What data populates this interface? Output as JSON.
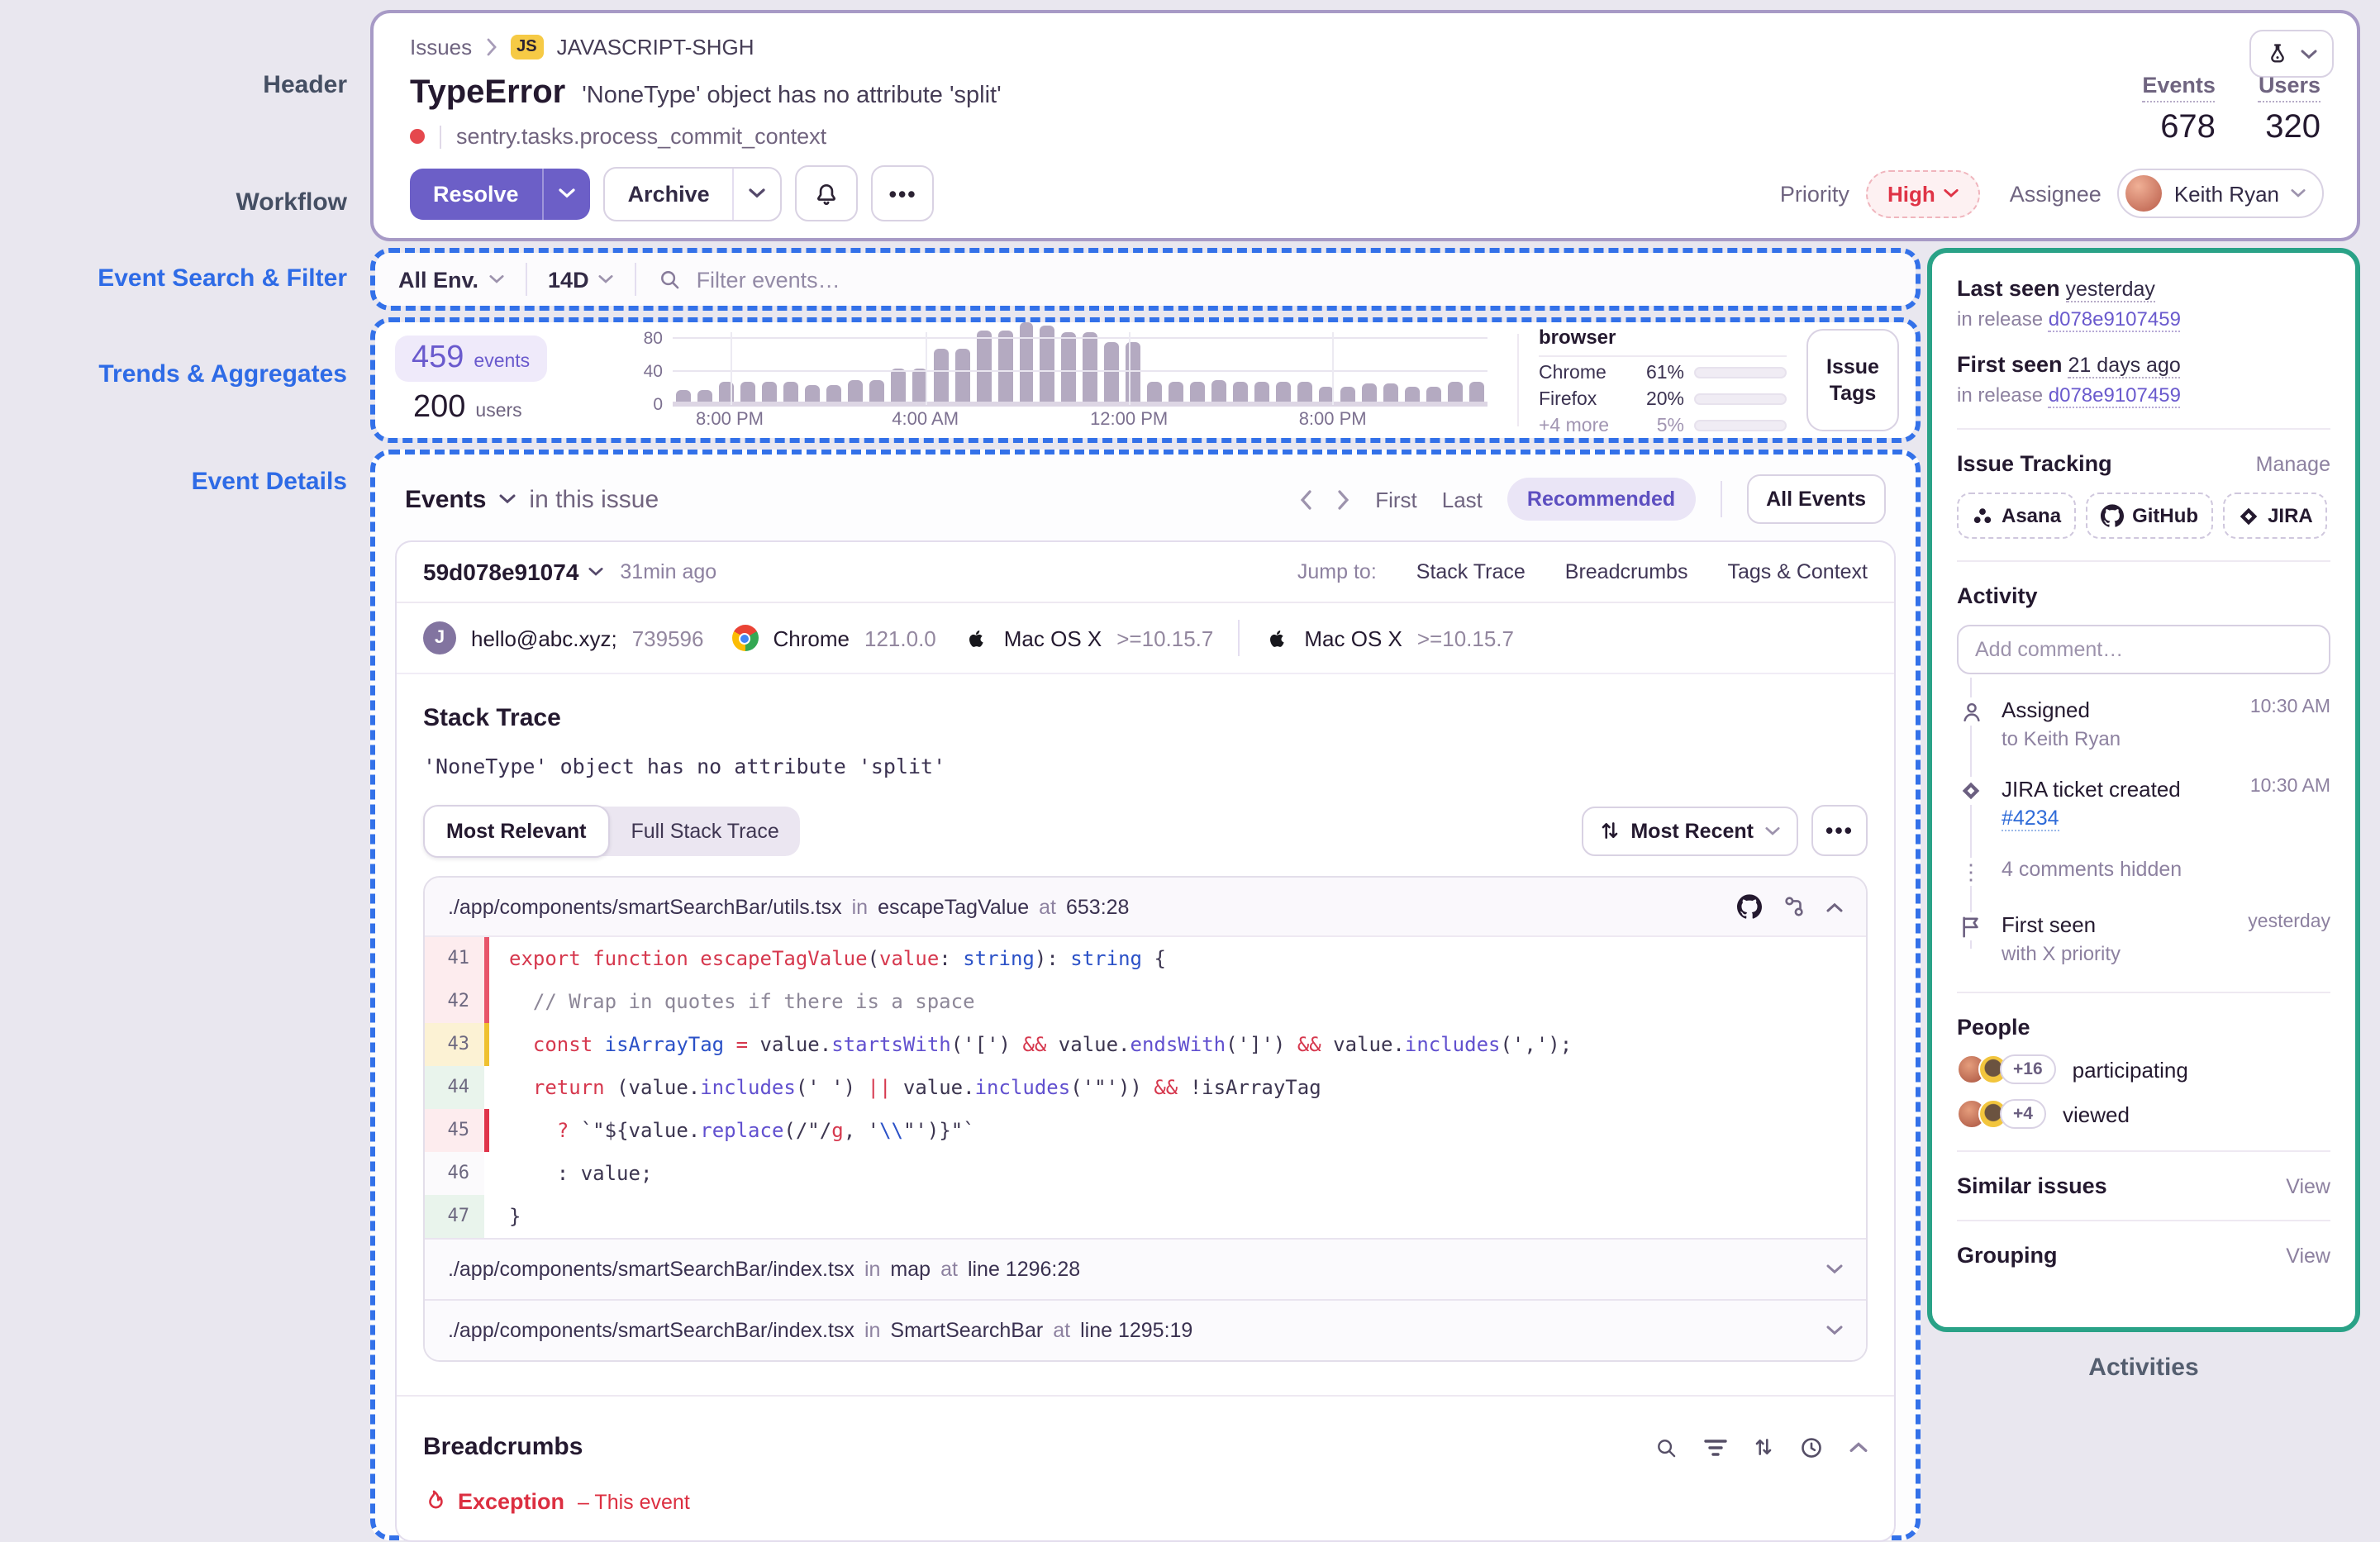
{
  "colors": {
    "accent_purple": "#6c5fc7",
    "error_red": "#e0344a",
    "annotation_blue": "#3371e9",
    "annotation_green": "#2aa287",
    "platform_badge_yellow": "#f6ca45",
    "chart_bar": "#b4aac1"
  },
  "annotations": {
    "header": "Header",
    "workflow": "Workflow",
    "search": "Event Search & Filter",
    "trends": "Trends & Aggregates",
    "details": "Event Details",
    "activities": "Activities"
  },
  "header": {
    "breadcrumb": {
      "issues": "Issues",
      "platform_badge": "JS",
      "project": "JAVASCRIPT-SHGH"
    },
    "title": "TypeError",
    "message": "'NoneType' object has no attribute 'split'",
    "culprit": "sentry.tasks.process_commit_context",
    "stats": {
      "events_label": "Events",
      "events_value": "678",
      "users_label": "Users",
      "users_value": "320"
    }
  },
  "workflow": {
    "resolve": "Resolve",
    "archive": "Archive",
    "priority_label": "Priority",
    "priority_value": "High",
    "assignee_label": "Assignee",
    "assignee_name": "Keith Ryan"
  },
  "filters": {
    "environment": "All Env.",
    "date_range": "14D",
    "search_placeholder": "Filter events…"
  },
  "trends": {
    "events_count": "459",
    "events_unit": "events",
    "users_count": "200",
    "users_unit": "users",
    "chart_data": {
      "type": "bar",
      "values": [
        18,
        18,
        28,
        28,
        28,
        28,
        24,
        24,
        31,
        31,
        45,
        45,
        68,
        68,
        90,
        90,
        100,
        96,
        88,
        88,
        76,
        76,
        28,
        28,
        29,
        30,
        28,
        28,
        28,
        28,
        22,
        22,
        26,
        26,
        22,
        22,
        28,
        28
      ],
      "ylim": [
        0,
        100
      ],
      "yticks": [
        0,
        40,
        80
      ],
      "xticks": [
        {
          "label": "8:00 PM",
          "pos": 7
        },
        {
          "label": "4:00 AM",
          "pos": 31
        },
        {
          "label": "12:00 PM",
          "pos": 56
        },
        {
          "label": "8:00 PM",
          "pos": 81
        }
      ],
      "grid": true,
      "legend": "none"
    },
    "browser": {
      "title": "browser",
      "rows": [
        {
          "name": "Chrome",
          "pct": "61%",
          "fill": 61,
          "muted": false
        },
        {
          "name": "Firefox",
          "pct": "20%",
          "fill": 20,
          "muted": false
        },
        {
          "name": "+4 more",
          "pct": "5%",
          "fill": 5,
          "muted": true
        }
      ]
    },
    "issue_tags_line1": "Issue",
    "issue_tags_line2": "Tags"
  },
  "events_header": {
    "title": "Events",
    "subtitle": "in this issue",
    "first": "First",
    "last": "Last",
    "recommended": "Recommended",
    "all_events": "All Events"
  },
  "event": {
    "id": "59d078e91074",
    "age": "31min ago",
    "jump_label": "Jump to:",
    "jump_links": [
      "Stack Trace",
      "Breadcrumbs",
      "Tags & Context"
    ],
    "user_email": "hello@abc.xyz;",
    "user_id": "739596",
    "browser_name": "Chrome",
    "browser_version": "121.0.0",
    "os_name": "Mac OS X",
    "os_version": ">=10.15.7",
    "device_os_name": "Mac OS X",
    "device_os_version": ">=10.15.7"
  },
  "stack_trace": {
    "title": "Stack Trace",
    "message": "'NoneType' object has no attribute 'split'",
    "tab_most_relevant": "Most Relevant",
    "tab_full": "Full Stack Trace",
    "sort_label": "Most Recent",
    "frame": {
      "path": "./app/components/smartSearchBar/utils.tsx",
      "in_label": "in",
      "function": "escapeTagValue",
      "at_label": "at",
      "location": "653:28"
    },
    "code_lines": [
      {
        "no": 41,
        "gutter": "warn-red",
        "tokens": [
          [
            "k",
            "export"
          ],
          [
            "d",
            " "
          ],
          [
            "k",
            "function"
          ],
          [
            "d",
            " "
          ],
          [
            "k",
            "escapeTagValue"
          ],
          [
            "d",
            "("
          ],
          [
            "k",
            "value"
          ],
          [
            "d",
            ": "
          ],
          [
            "b",
            "string"
          ],
          [
            "d",
            "): "
          ],
          [
            "b",
            "string"
          ],
          [
            "d",
            " {"
          ]
        ]
      },
      {
        "no": 42,
        "gutter": "warn-red",
        "tokens": [
          [
            "c",
            "  // Wrap in quotes if there is a space"
          ]
        ]
      },
      {
        "no": 43,
        "gutter": "warn-yellow",
        "tokens": [
          [
            "d",
            "  "
          ],
          [
            "k",
            "const"
          ],
          [
            "d",
            " "
          ],
          [
            "b",
            "isArrayTag"
          ],
          [
            "d",
            " "
          ],
          [
            "k",
            "="
          ],
          [
            "d",
            " value."
          ],
          [
            "m",
            "startsWith"
          ],
          [
            "d",
            "('[') "
          ],
          [
            "k",
            "&&"
          ],
          [
            "d",
            " value."
          ],
          [
            "m",
            "endsWith"
          ],
          [
            "d",
            "(']') "
          ],
          [
            "k",
            "&&"
          ],
          [
            "d",
            " value."
          ],
          [
            "m",
            "includes"
          ],
          [
            "d",
            "(',');"
          ]
        ]
      },
      {
        "no": 44,
        "gutter": "ctx-green",
        "tokens": [
          [
            "d",
            "  "
          ],
          [
            "k",
            "return"
          ],
          [
            "d",
            " (value."
          ],
          [
            "m",
            "includes"
          ],
          [
            "d",
            "(' ') "
          ],
          [
            "k",
            "||"
          ],
          [
            "d",
            " value."
          ],
          [
            "m",
            "includes"
          ],
          [
            "d",
            "('\"')) "
          ],
          [
            "k",
            "&&"
          ],
          [
            "d",
            " !isArrayTag"
          ]
        ]
      },
      {
        "no": 45,
        "gutter": "err",
        "tokens": [
          [
            "d",
            "    "
          ],
          [
            "k",
            "?"
          ],
          [
            "d",
            " `\"${value."
          ],
          [
            "m",
            "replace"
          ],
          [
            "d",
            "(/\"/"
          ],
          [
            "k",
            "g"
          ],
          [
            "d",
            ", '"
          ],
          [
            "b",
            "\\\\"
          ],
          [
            "d",
            "\"')}\"`"
          ]
        ]
      },
      {
        "no": 46,
        "gutter": "plain",
        "tokens": [
          [
            "d",
            "    : value;"
          ]
        ]
      },
      {
        "no": 47,
        "gutter": "ctx-green",
        "tokens": [
          [
            "d",
            "}"
          ]
        ]
      }
    ],
    "collapsed_frames": [
      {
        "path": "./app/components/smartSearchBar/index.tsx",
        "in_label": "in",
        "function": "map",
        "at_label": "at",
        "location": "line 1296:28"
      },
      {
        "path": "./app/components/smartSearchBar/index.tsx",
        "in_label": "in",
        "function": "SmartSearchBar",
        "at_label": "at",
        "location": "line 1295:19"
      }
    ]
  },
  "breadcrumbs": {
    "title": "Breadcrumbs",
    "exception_label": "Exception",
    "exception_note": "– This event"
  },
  "sidebar": {
    "last_seen_label": "Last seen",
    "last_seen_value": "yesterday",
    "last_release_prefix": "in release",
    "last_release": "d078e9107459",
    "first_seen_label": "First seen",
    "first_seen_value": "21 days ago",
    "first_release_prefix": "in release",
    "first_release": "d078e9107459",
    "issue_tracking": {
      "title": "Issue Tracking",
      "manage": "Manage",
      "integrations": [
        {
          "name": "Asana",
          "icon": "asana-icon"
        },
        {
          "name": "GitHub",
          "icon": "github-icon"
        },
        {
          "name": "JIRA",
          "icon": "jira-icon"
        }
      ]
    },
    "activity": {
      "title": "Activity",
      "comment_placeholder": "Add comment…",
      "items": [
        {
          "icon": "user-icon",
          "title": "Assigned",
          "detail": "to Keith Ryan",
          "time": "10:30 AM"
        },
        {
          "icon": "diamond-icon",
          "title": "JIRA ticket created",
          "link": "#4234",
          "time": "10:30 AM"
        },
        {
          "icon": "dots-icon",
          "muted": "4 comments hidden"
        },
        {
          "icon": "flag-icon",
          "title": "First seen",
          "detail": "with X priority",
          "time": "yesterday"
        }
      ]
    },
    "people": {
      "title": "People",
      "rows": [
        {
          "count": "+16",
          "label": "participating"
        },
        {
          "count": "+4",
          "label": "viewed"
        }
      ]
    },
    "similar_issues": {
      "title": "Similar issues",
      "action": "View"
    },
    "grouping": {
      "title": "Grouping",
      "action": "View"
    }
  }
}
